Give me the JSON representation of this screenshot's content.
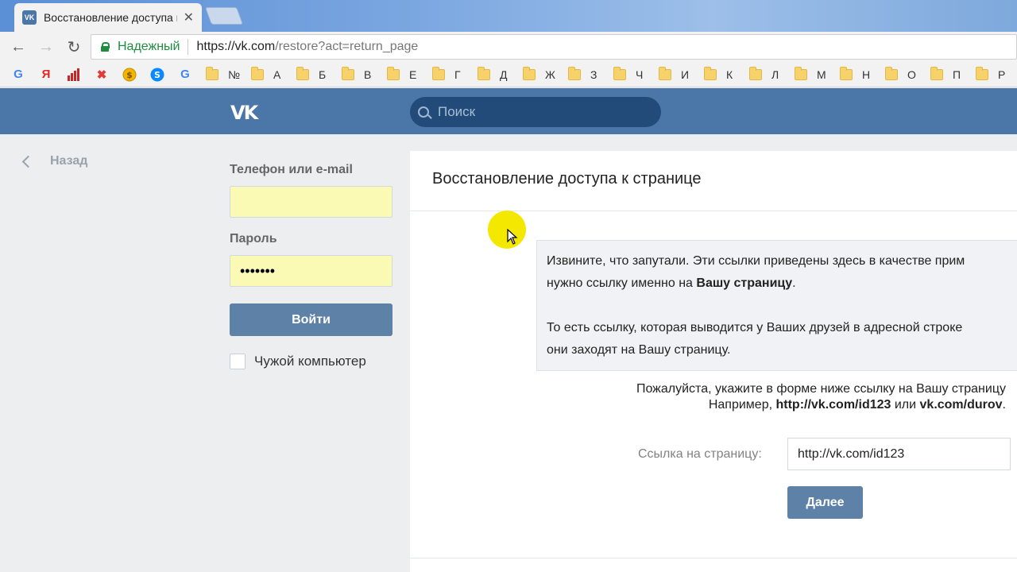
{
  "browser": {
    "tab_title": "Восстановление доступа к странице",
    "tab_favicon": "VK",
    "secure_label": "Надежный",
    "url_host": "https://vk.com",
    "url_path": "/restore?act=return_page",
    "bookmark_icons": [
      "google-icon",
      "yandex-icon",
      "stats-icon",
      "tools-icon",
      "coin-icon",
      "shazam-icon",
      "google-icon"
    ],
    "bookmark_folders": [
      "№",
      "А",
      "Б",
      "В",
      "Е",
      "Г",
      "Д",
      "Ж",
      "З",
      "Ч",
      "И",
      "К",
      "Л",
      "М",
      "Н",
      "О",
      "П",
      "Р"
    ]
  },
  "header": {
    "logo": "VK",
    "search_placeholder": "Поиск"
  },
  "sidebar": {
    "back_label": "Назад",
    "login_label": "Телефон или e-mail",
    "login_value": "",
    "password_label": "Пароль",
    "password_value": "•••••••",
    "login_button": "Войти",
    "remember_label": "Чужой компьютер"
  },
  "main": {
    "title": "Восстановление доступа к странице",
    "info_p1_line1": "Извините, что запутали. Эти ссылки приведены здесь в качестве прим",
    "info_p1_line2_start": "нужно ссылку именно на ",
    "info_p1_line2_bold": "Вашу страницу",
    "info_p1_line2_end": ".",
    "info_p2_line1": "То есть ссылку, которая выводится у Ваших друзей в адресной строке",
    "info_p2_line2": "они заходят на Вашу страницу.",
    "instruction_line1": "Пожалуйста, укажите в форме ниже ссылку на Вашу страницу",
    "instruction_example_prefix": "Например, ",
    "instruction_example_1": "http://vk.com/id123",
    "instruction_example_or": " или ",
    "instruction_example_2": "vk.com/durov",
    "instruction_example_end": ".",
    "link_label": "Ссылка на страницу:",
    "link_value": "http://vk.com/id123",
    "next_button": "Далее"
  },
  "colors": {
    "vk_blue": "#4a76a8",
    "button_blue": "#5e81a8",
    "autofill_yellow": "#fafab4",
    "secure_green": "#1e8e3e",
    "cursor_highlight": "#f5e800"
  }
}
